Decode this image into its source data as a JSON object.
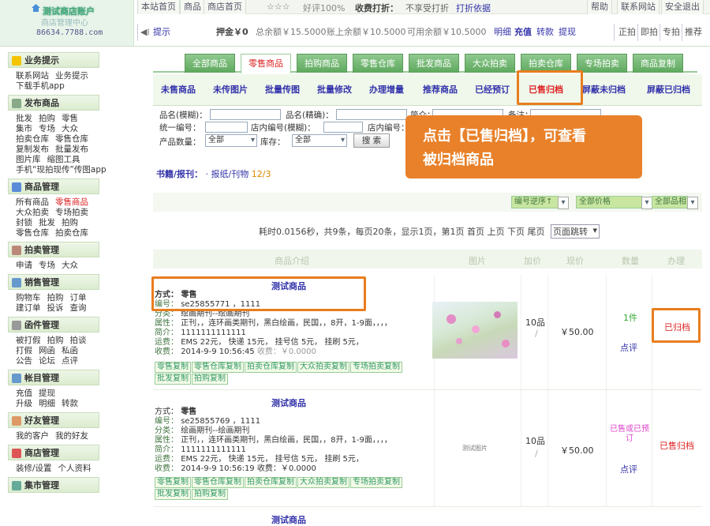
{
  "header": {
    "account_title": "测试商店账户",
    "account_sub": "商店管理中心",
    "domain": "86634.7788.com",
    "nav": [
      "本站首页",
      "商品",
      "商店首页"
    ],
    "stars": "☆☆☆",
    "rating": "好评100%",
    "shipping_label": "收费打折：",
    "shipping_value": "不享受打折",
    "discount_link": "打折依据",
    "right_links": [
      "帮助",
      "联系网站",
      "安全退出"
    ],
    "tip": "提示",
    "deposit": "押金￥0",
    "total_balance": "总余额￥15.5000",
    "account_balance": "账上余额￥10.5000",
    "available_balance": "可用余额￥10.5000",
    "detail_links": [
      "明细",
      "充值",
      "转款",
      "提现"
    ],
    "auction_links": [
      "正拍",
      "即拍",
      "专拍",
      "推荐"
    ]
  },
  "sidebar": {
    "sections": [
      {
        "title": "业务提示",
        "rows": [
          [
            "联系网站",
            "业务提示"
          ],
          [
            "下载手机app"
          ]
        ]
      },
      {
        "title": "发布商品",
        "rows": [
          [
            "批发",
            "拍购",
            "零售"
          ],
          [
            "集市",
            "专场",
            "大众"
          ],
          [
            "拍卖仓库",
            "零售仓库"
          ],
          [
            "复制发布",
            "批量发布"
          ],
          [
            "图片库",
            "缩图工具"
          ],
          [
            "手机“现拍现传”传图app"
          ]
        ]
      },
      {
        "title": "商品管理",
        "rows": [
          [
            "所有商品",
            "零售商品"
          ],
          [
            "大众拍卖",
            "专场拍卖"
          ],
          [
            "封锁",
            "批发",
            "拍购"
          ],
          [
            "零售仓库",
            "拍卖仓库"
          ]
        ]
      },
      {
        "title": "拍卖管理",
        "rows": [
          [
            "申请",
            "专场",
            "大众"
          ]
        ]
      },
      {
        "title": "销售管理",
        "rows": [
          [
            "购物车",
            "拍购",
            "订单"
          ],
          [
            "建订单",
            "投诉",
            "查询"
          ]
        ]
      },
      {
        "title": "函件管理",
        "rows": [
          [
            "被打假",
            "拍购",
            "拍谈"
          ],
          [
            "打假",
            "网函",
            "私函"
          ],
          [
            "公告",
            "论坛",
            "点评"
          ]
        ]
      },
      {
        "title": "帐目管理",
        "rows": [
          [
            "充值",
            "提现"
          ],
          [
            "升级",
            "明细",
            "转款"
          ]
        ]
      },
      {
        "title": "好友管理",
        "rows": [
          [
            "我的客户",
            "我的好友"
          ]
        ]
      },
      {
        "title": "商店管理",
        "rows": [
          [
            "装修/设置",
            "个人资料"
          ]
        ]
      },
      {
        "title": "集市管理",
        "rows": []
      }
    ]
  },
  "tabs": [
    "全部商品",
    "零售商品",
    "拍购商品",
    "零售仓库",
    "批发商品",
    "大众拍卖",
    "拍卖仓库",
    "专场拍卖",
    "商品复制"
  ],
  "subtabs": [
    "未售商品",
    "未传图片",
    "批量传图",
    "批量修改",
    "办理增量",
    "推荐商品",
    "已经预订",
    "已售归档",
    "屏蔽未归档",
    "屏蔽已归档"
  ],
  "filters": {
    "name_fuzzy": "品名(模糊)：",
    "name_exact": "品名(精确)：",
    "intro": "简介：",
    "note": "备注：",
    "uid": "统一编号：",
    "shop_id": "店内编号(模糊)：",
    "shop_id_exact": "店内编号：",
    "qty": "产品数量：",
    "qty_value": "全部",
    "stock": "库存：",
    "stock_value": "全部",
    "search": "搜 索"
  },
  "callout": {
    "line1": "点击【已售归档】，可查看",
    "line2": "被归档商品"
  },
  "books": {
    "label": "书籍/报刊：",
    "link": "报纸/刊物",
    "count": "12/3"
  },
  "sort": {
    "order": "编号逆序↑",
    "price": "全部价格",
    "category": "全部品相"
  },
  "pager": {
    "text": "耗时0.0156秒，共9条，每页20条，显示1页，第1页 首页 上页 下页  尾页",
    "jump": "页面跳转"
  },
  "columns": [
    "商品介绍",
    "图片",
    "加价",
    "现价",
    "数量",
    "办理"
  ],
  "products": [
    {
      "title": "测试商品",
      "method": "零售",
      "code": "se25855771 ，1111",
      "category": "绘画期刊--绘画期刊",
      "attrs": "正刊，，连环画类期刊，黑白绘画，民国，，8开，1-9面，，，，",
      "intro": "1111111111111",
      "shipping": "EMS 22元， 快递 15元， 挂号信 5元， 挂刷 5元，",
      "received": "2014-9-9 10:56:45",
      "fee": "收费：￥0.0000",
      "tags": [
        "零售复制",
        "零售仓库复制",
        "拍卖仓库复制",
        "大众拍卖复制",
        "专场拍卖复制",
        "批发复制",
        "拍购复制"
      ],
      "grade": "10品",
      "price": "￥50.00",
      "qty": "1件",
      "review": "点评",
      "status": "已归档",
      "image": "photo"
    },
    {
      "title": "测试商品",
      "method": "零售",
      "code": "se25855769 ，1111",
      "category": "绘画期刊--绘画期刊",
      "attrs": "正刊，，连环画类期刊，黑白绘画，民国，，8开，1-9面，，，，",
      "intro": "1111111111111",
      "shipping": "EMS 22元， 快递 15元， 挂号信 5元， 挂刷 5元，",
      "received": "2014-9-9 10:56:19",
      "fee": "收费：￥0.0000",
      "tags": [
        "零售复制",
        "零售仓库复制",
        "拍卖仓库复制",
        "大众拍卖复制",
        "专场拍卖复制",
        "批发复制",
        "拍购复制"
      ],
      "grade": "10品",
      "price": "￥50.00",
      "qty": "已售或已预订",
      "review": "点评",
      "status": "已售归档",
      "image_text": "测试图片"
    },
    {
      "title": "测试商品"
    }
  ],
  "colors": {
    "accent": "#e87d1e",
    "green": "#5da85d",
    "red": "#d22"
  }
}
